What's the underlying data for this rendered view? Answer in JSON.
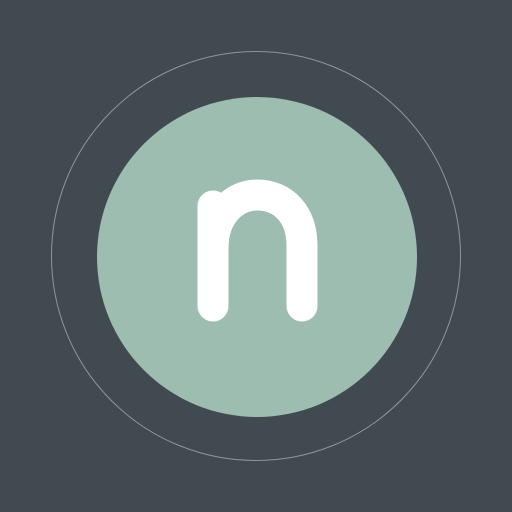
{
  "app_icon": {
    "icon_name": "letter-n-logo",
    "letter": "n",
    "colors": {
      "background": "#424a51",
      "ring": "#8e9792",
      "disc": "#9dbdb0",
      "glyph": "#ffffff"
    }
  }
}
